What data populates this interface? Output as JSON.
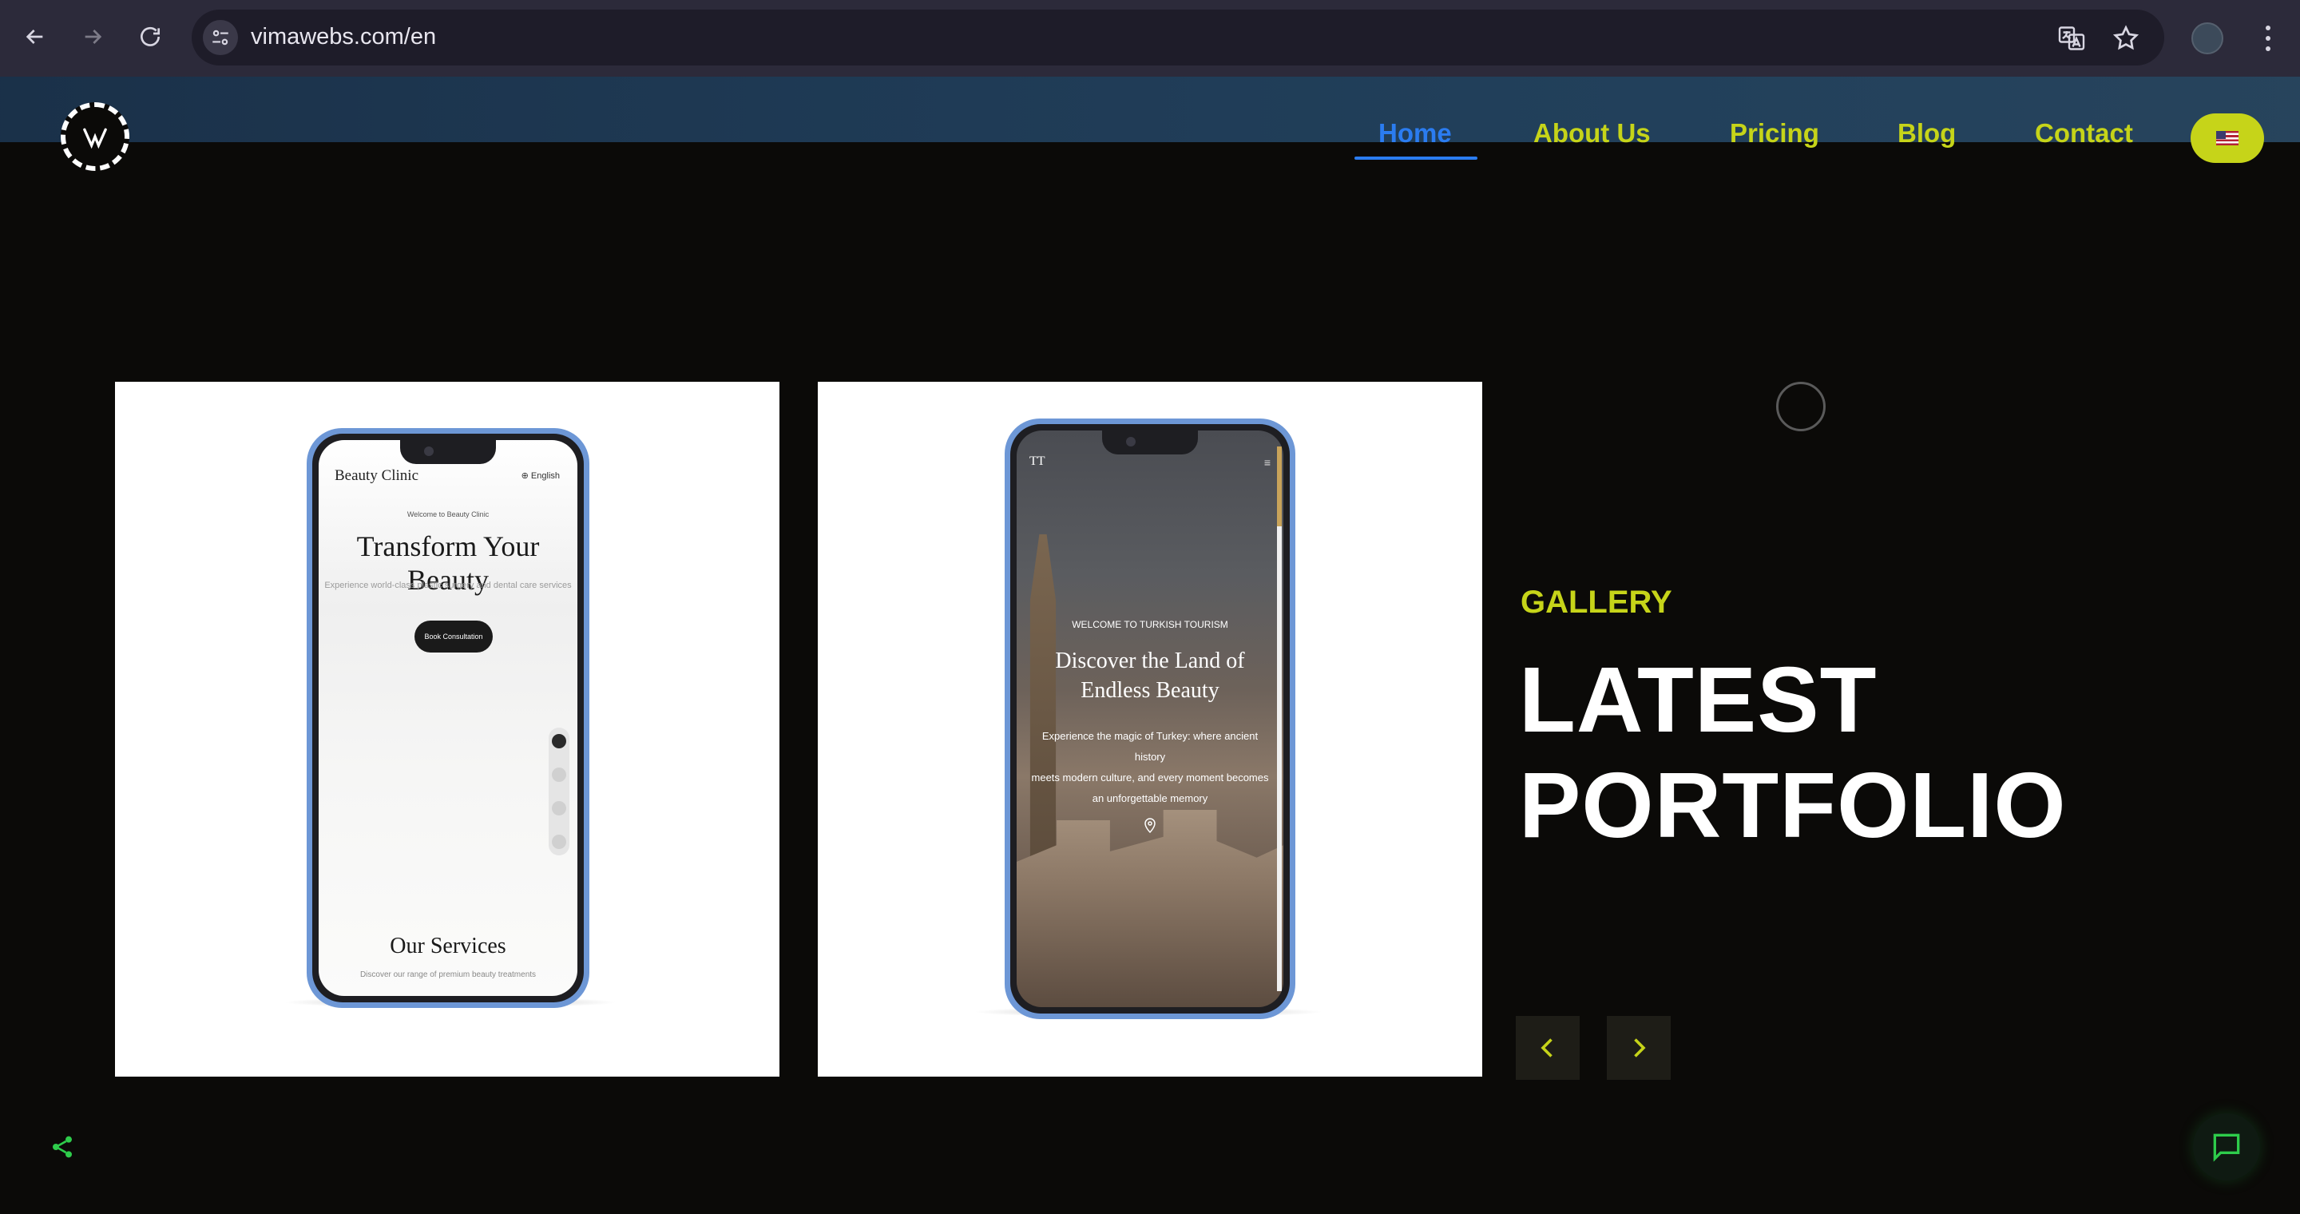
{
  "browser": {
    "url": "vimawebs.com/en"
  },
  "nav": {
    "items": [
      {
        "label": "Home",
        "active": true
      },
      {
        "label": "About Us",
        "active": false
      },
      {
        "label": "Pricing",
        "active": false
      },
      {
        "label": "Blog",
        "active": false
      },
      {
        "label": "Contact",
        "active": false
      }
    ],
    "language_flag": "us-flag-icon"
  },
  "portfolio": {
    "card1": {
      "brand": "Beauty Clinic",
      "language": "English",
      "welcome": "Welcome to Beauty Clinic",
      "title": "Transform Your Beauty",
      "subtitle": "Experience world-class plastic surgery and dental care services",
      "button": "Book Consultation",
      "services_title": "Our Services",
      "services_subtitle": "Discover our range of premium beauty treatments"
    },
    "card2": {
      "logo": "TT",
      "welcome": "WELCOME TO TURKISH TOURISM",
      "title_line1": "Discover the Land of",
      "title_line2": "Endless Beauty",
      "desc_line1": "Experience the magic of Turkey: where ancient history",
      "desc_line2": "meets modern culture, and every moment becomes",
      "desc_line3": "an unforgettable memory"
    }
  },
  "hero": {
    "label": "GALLERY",
    "headline_line1": "LATEST",
    "headline_line2": "PORTFOLIO"
  },
  "colors": {
    "accent": "#c6d419",
    "active_link": "#2b7cf0",
    "background": "#0b0a08",
    "floating_green": "#2ecc4b"
  }
}
